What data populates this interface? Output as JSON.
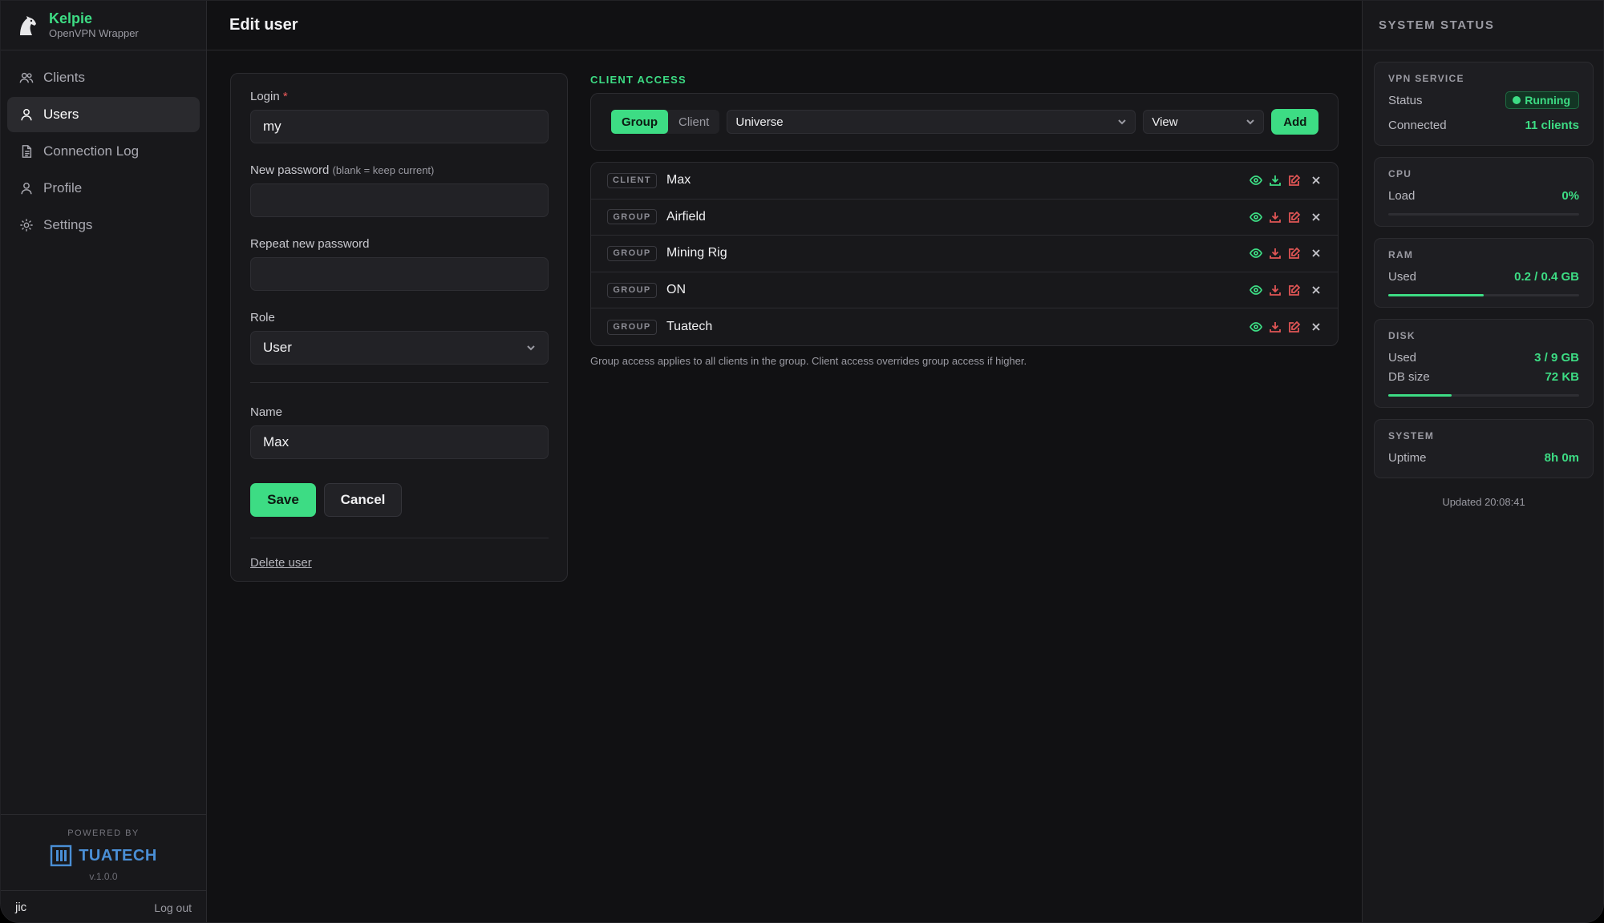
{
  "brand": {
    "title": "Kelpie",
    "subtitle": "OpenVPN Wrapper"
  },
  "nav": [
    {
      "id": "clients",
      "label": "Clients",
      "icon": "users-icon"
    },
    {
      "id": "users",
      "label": "Users",
      "icon": "user-icon",
      "active": true
    },
    {
      "id": "connection-log",
      "label": "Connection Log",
      "icon": "document-icon"
    },
    {
      "id": "profile",
      "label": "Profile",
      "icon": "user-icon"
    },
    {
      "id": "settings",
      "label": "Settings",
      "icon": "gear-icon"
    }
  ],
  "footer": {
    "powered_label": "POWERED BY",
    "company": "TUATECH",
    "version": "v.1.0.0",
    "username": "jic",
    "logout_label": "Log out"
  },
  "page": {
    "title": "Edit user"
  },
  "form": {
    "login_label": "Login",
    "required_mark": "*",
    "login_value": "my",
    "new_password_label": "New password",
    "new_password_hint": "(blank = keep current)",
    "new_password_value": "",
    "repeat_password_label": "Repeat new password",
    "repeat_password_value": "",
    "role_label": "Role",
    "role_value": "User",
    "name_label": "Name",
    "name_value": "Max",
    "save_label": "Save",
    "cancel_label": "Cancel",
    "delete_label": "Delete user"
  },
  "access": {
    "section_label": "CLIENT ACCESS",
    "toggle": {
      "group_label": "Group",
      "client_label": "Client",
      "selected": "Group"
    },
    "target_value": "Universe",
    "permission_value": "View",
    "add_label": "Add",
    "rows": [
      {
        "type": "CLIENT",
        "name": "Max"
      },
      {
        "type": "GROUP",
        "name": "Airfield"
      },
      {
        "type": "GROUP",
        "name": "Mining Rig"
      },
      {
        "type": "GROUP",
        "name": "ON"
      },
      {
        "type": "GROUP",
        "name": "Tuatech"
      }
    ],
    "note": "Group access applies to all clients in the group. Client access overrides group access if higher."
  },
  "status": {
    "header": "SYSTEM STATUS",
    "vpn": {
      "title": "VPN SERVICE",
      "status_label": "Status",
      "status_value": "Running",
      "connected_label": "Connected",
      "connected_value": "11 clients"
    },
    "cpu": {
      "title": "CPU",
      "load_label": "Load",
      "load_value": "0%",
      "load_fraction": 0.0
    },
    "ram": {
      "title": "RAM",
      "used_label": "Used",
      "used_value": "0.2 / 0.4 GB",
      "used_fraction": 0.5
    },
    "disk": {
      "title": "DISK",
      "used_label": "Used",
      "used_value": "3 / 9 GB",
      "db_label": "DB size",
      "db_value": "72 KB",
      "used_fraction": 0.33
    },
    "system": {
      "title": "SYSTEM",
      "uptime_label": "Uptime",
      "uptime_value": "8h 0m"
    },
    "updated": "Updated 20:08:41"
  },
  "colors": {
    "accent": "#3ddc84",
    "danger": "#e05555",
    "brand_blue": "#4a8fd6"
  }
}
